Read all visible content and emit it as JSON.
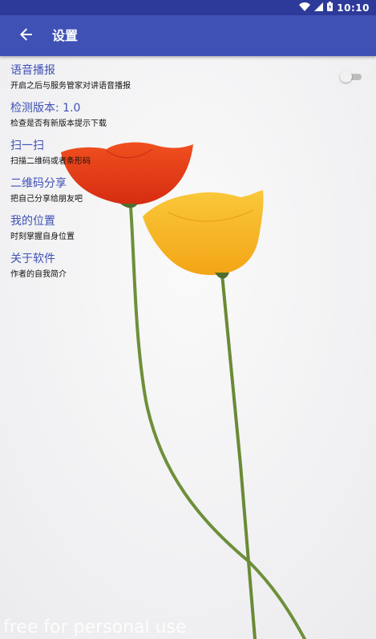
{
  "status_bar": {
    "time": "10:10",
    "icons": [
      "wifi-icon",
      "cell-signal-icon",
      "battery-icon"
    ]
  },
  "app_bar": {
    "title": "设置",
    "back_icon": "arrow-left-icon"
  },
  "settings": [
    {
      "title": "语音播报",
      "desc": "开启之后与服务管家对讲语音播报",
      "toggle": false
    },
    {
      "title": "检测版本: 1.0",
      "desc": "检查是否有新版本提示下载"
    },
    {
      "title": "扫一扫",
      "desc": "扫描二维码或者条形码"
    },
    {
      "title": "二维码分享",
      "desc": "把自己分享给朋友吧"
    },
    {
      "title": "我的位置",
      "desc": "时刻掌握自身位置"
    },
    {
      "title": "关于软件",
      "desc": "作者的自我简介"
    }
  ],
  "watermark": "free for personal use",
  "colors": {
    "status_bar": "#2d3a99",
    "app_bar": "#3f51b5",
    "accent_text": "#3f51b5",
    "flower_red": "#e8391c",
    "flower_yellow": "#f7b21d",
    "stem": "#6e8f3a"
  }
}
